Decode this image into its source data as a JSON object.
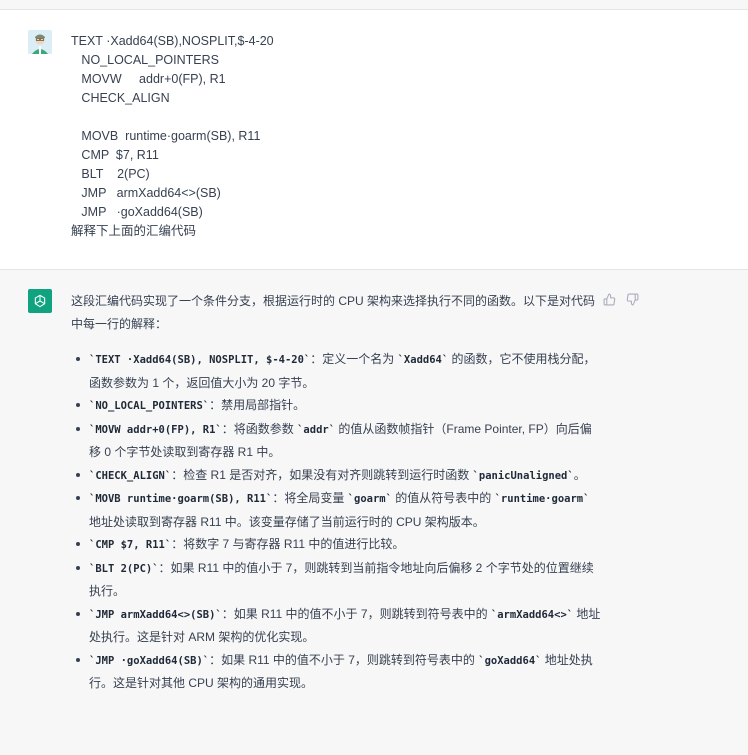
{
  "user": {
    "avatar_icon": "user-avatar-icon",
    "message": "TEXT ·Xadd64(SB),NOSPLIT,$-4-20\n   NO_LOCAL_POINTERS\n   MOVW     addr+0(FP), R1\n   CHECK_ALIGN\n\n   MOVB  runtime·goarm(SB), R11\n   CMP  $7, R11\n   BLT    2(PC)\n   JMP   armXadd64<>(SB)\n   JMP   ·goXadd64(SB)\n解释下上面的汇编代码"
  },
  "assistant": {
    "avatar_icon": "openai-logo-icon",
    "intro": "这段汇编代码实现了一个条件分支，根据运行时的 CPU 架构来选择执行不同的函数。以下是对代码中每一行的解释：",
    "items": [
      {
        "code": "`TEXT ·Xadd64(SB), NOSPLIT, $-4-20`",
        "pre": "",
        "post": "：定义一个名为 ",
        "code2": "`Xadd64`",
        "post2": " 的函数，它不使用栈分配，函数参数为 1 个，返回值大小为 20 字节。"
      },
      {
        "code": "`NO_LOCAL_POINTERS`",
        "pre": "",
        "post": "：禁用局部指针。",
        "code2": "",
        "post2": ""
      },
      {
        "code": "`MOVW addr+0(FP), R1`",
        "pre": "",
        "post": "：将函数参数 ",
        "code2": "`addr`",
        "post2": " 的值从函数帧指针（Frame Pointer, FP）向后偏移 0 个字节处读取到寄存器 R1 中。"
      },
      {
        "code": "`CHECK_ALIGN`",
        "pre": "",
        "post": "：检查 R1 是否对齐，如果没有对齐则跳转到运行时函数 ",
        "code2": "`panicUnaligned`",
        "post2": "。"
      },
      {
        "code": "`MOVB runtime·goarm(SB), R11`",
        "pre": "",
        "post": "：将全局变量 ",
        "code2": "`goarm`",
        "post2": " 的值从符号表中的 ",
        "code3": "`runtime·goarm`",
        "post3": " 地址处读取到寄存器 R11 中。该变量存储了当前运行时的 CPU 架构版本。"
      },
      {
        "code": "`CMP $7, R11`",
        "pre": "",
        "post": "：将数字 7 与寄存器 R11 中的值进行比较。",
        "code2": "",
        "post2": ""
      },
      {
        "code": "`BLT 2(PC)`",
        "pre": "",
        "post": "：如果 R11 中的值小于 7，则跳转到当前指令地址向后偏移 2 个字节处的位置继续执行。",
        "code2": "",
        "post2": ""
      },
      {
        "code": "`JMP armXadd64<>(SB)`",
        "pre": "",
        "post": "：如果 R11 中的值不小于 7，则跳转到符号表中的 ",
        "code2": "`armXadd64<>`",
        "post2": " 地址处执行。这是针对 ARM 架构的优化实现。"
      },
      {
        "code": "`JMP ·goXadd64(SB)`",
        "pre": "",
        "post": "：如果 R11 中的值不小于 7，则跳转到符号表中的 ",
        "code2": "`goXadd64`",
        "post2": " 地址处执行。这是针对其他 CPU 架构的通用实现。"
      }
    ],
    "actions": {
      "thumbs_up_icon": "thumbs-up-icon",
      "thumbs_down_icon": "thumbs-down-icon"
    }
  },
  "colors": {
    "bot_avatar": "#10a37f",
    "assistant_bg": "#f7f7f8"
  }
}
